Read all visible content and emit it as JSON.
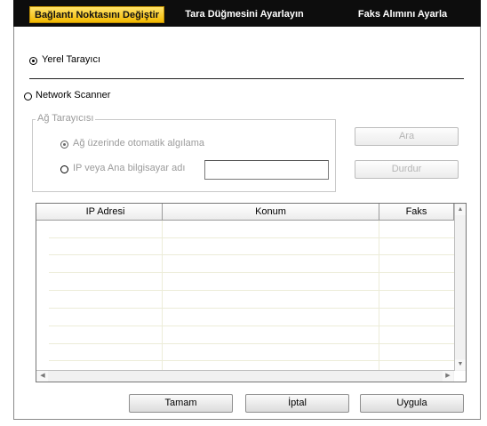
{
  "tabs": [
    {
      "label": "Bağlantı Noktasını Değiştir",
      "active": true
    },
    {
      "label": "Tara Düğmesini Ayarlayın",
      "active": false
    },
    {
      "label": "Faks Alımını Ayarla",
      "active": false
    }
  ],
  "local_scanner": {
    "label": "Yerel Tarayıcı",
    "selected": true
  },
  "network_scanner": {
    "label": "Network Scanner",
    "selected": false
  },
  "group": {
    "title": "Ağ Tarayıcısı",
    "auto_detect_label": "Ağ üzerinde otomatik algılama",
    "ip_label": "IP veya Ana bilgisayar adı",
    "ip_value": "",
    "search_button": "Ara",
    "stop_button": "Durdur"
  },
  "table": {
    "columns": [
      "IP Adresi",
      "Konum",
      "Faks"
    ],
    "rows": []
  },
  "footer": {
    "ok_button": "Tamam",
    "cancel_button": "İptal",
    "apply_button": "Uygula"
  },
  "colors": {
    "tab_active": "#f2b800",
    "tab_bar": "#0d0d0d"
  }
}
